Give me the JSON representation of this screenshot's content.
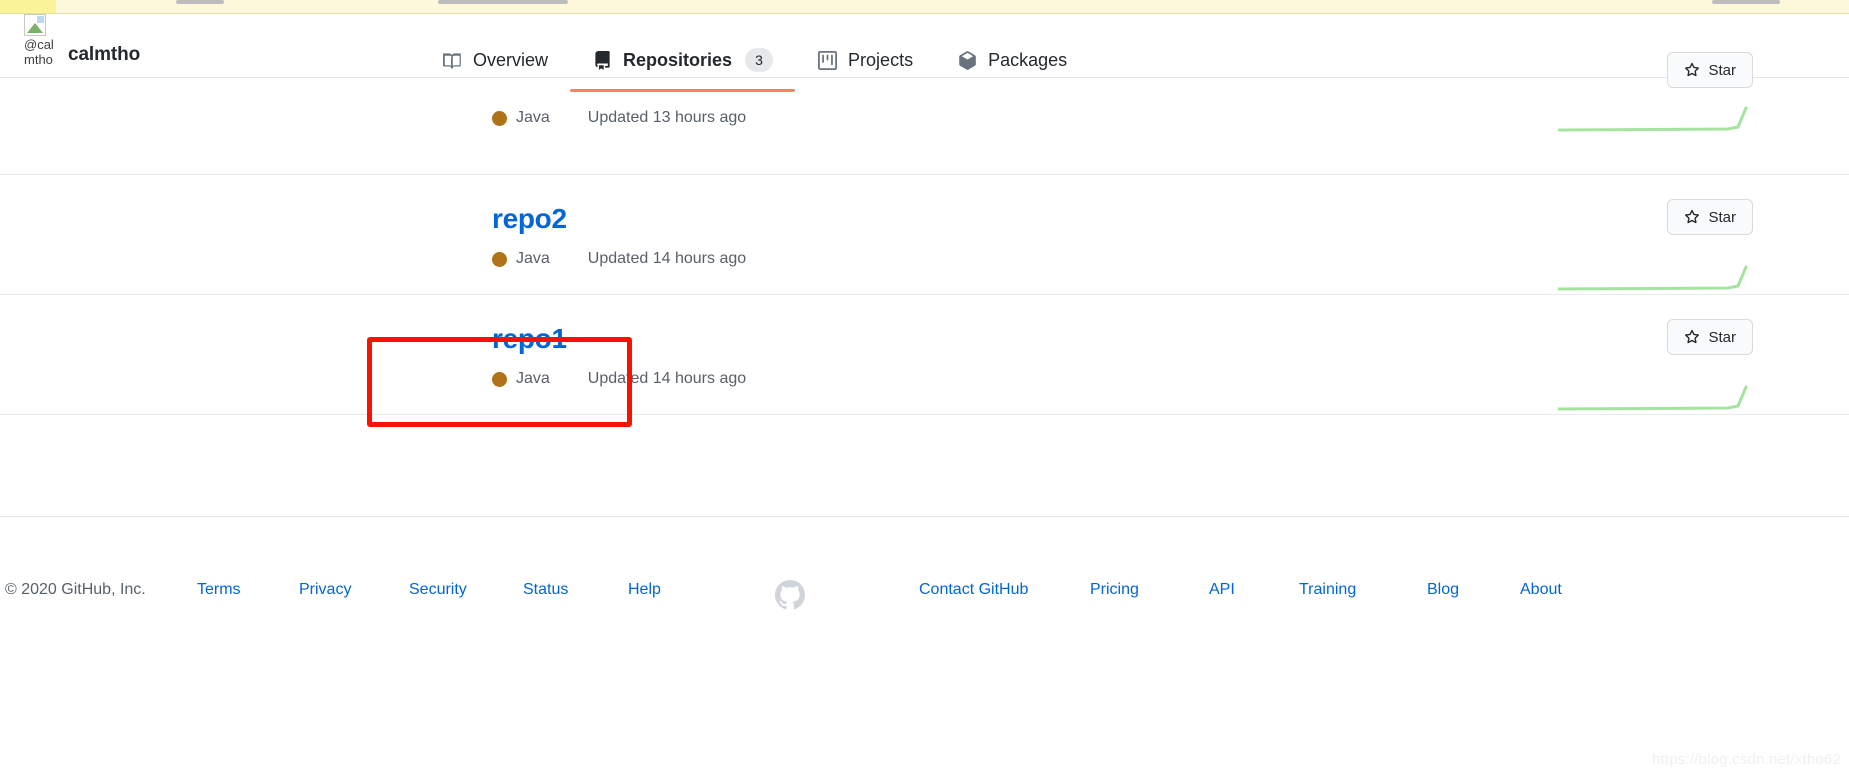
{
  "browser": {
    "notification_strip_color": "#fdf8dc"
  },
  "profile": {
    "avatar_alt": "@calmtho",
    "username": "calmtho"
  },
  "nav": {
    "tabs": [
      {
        "label": "Overview",
        "icon": "book-icon",
        "active": false,
        "count": null
      },
      {
        "label": "Repositories",
        "icon": "repo-icon",
        "active": true,
        "count": "3"
      },
      {
        "label": "Projects",
        "icon": "project-icon",
        "active": false,
        "count": null
      },
      {
        "label": "Packages",
        "icon": "package-icon",
        "active": false,
        "count": null
      }
    ]
  },
  "repositories": {
    "star_label": "Star",
    "star_icon": "star-icon",
    "items": [
      {
        "name": "",
        "clipped": true,
        "language": "Java",
        "language_color": "#b07219",
        "updated": "Updated 13 hours ago",
        "highlighted": false
      },
      {
        "name": "repo2",
        "clipped": false,
        "language": "Java",
        "language_color": "#b07219",
        "updated": "Updated 14 hours ago",
        "highlighted": false
      },
      {
        "name": "repo1",
        "clipped": false,
        "language": "Java",
        "language_color": "#b07219",
        "updated": "Updated 14 hours ago",
        "highlighted": true
      }
    ]
  },
  "annotation": {
    "color": "#fb1100",
    "target": "repo1"
  },
  "footer": {
    "copyright": "© 2020 GitHub, Inc.",
    "left_links": [
      "Terms",
      "Privacy",
      "Security",
      "Status",
      "Help"
    ],
    "right_links": [
      "Contact GitHub",
      "Pricing",
      "API",
      "Training",
      "Blog",
      "About"
    ],
    "logo_icon": "github-mark-icon"
  },
  "watermark": {
    "text": "https://blog.csdn.net/xtho62"
  },
  "colors": {
    "link": "#0366d6",
    "active_tab_underline": "#f9826c",
    "muted_text": "#586069",
    "sparkline": "#a6e3a1"
  }
}
